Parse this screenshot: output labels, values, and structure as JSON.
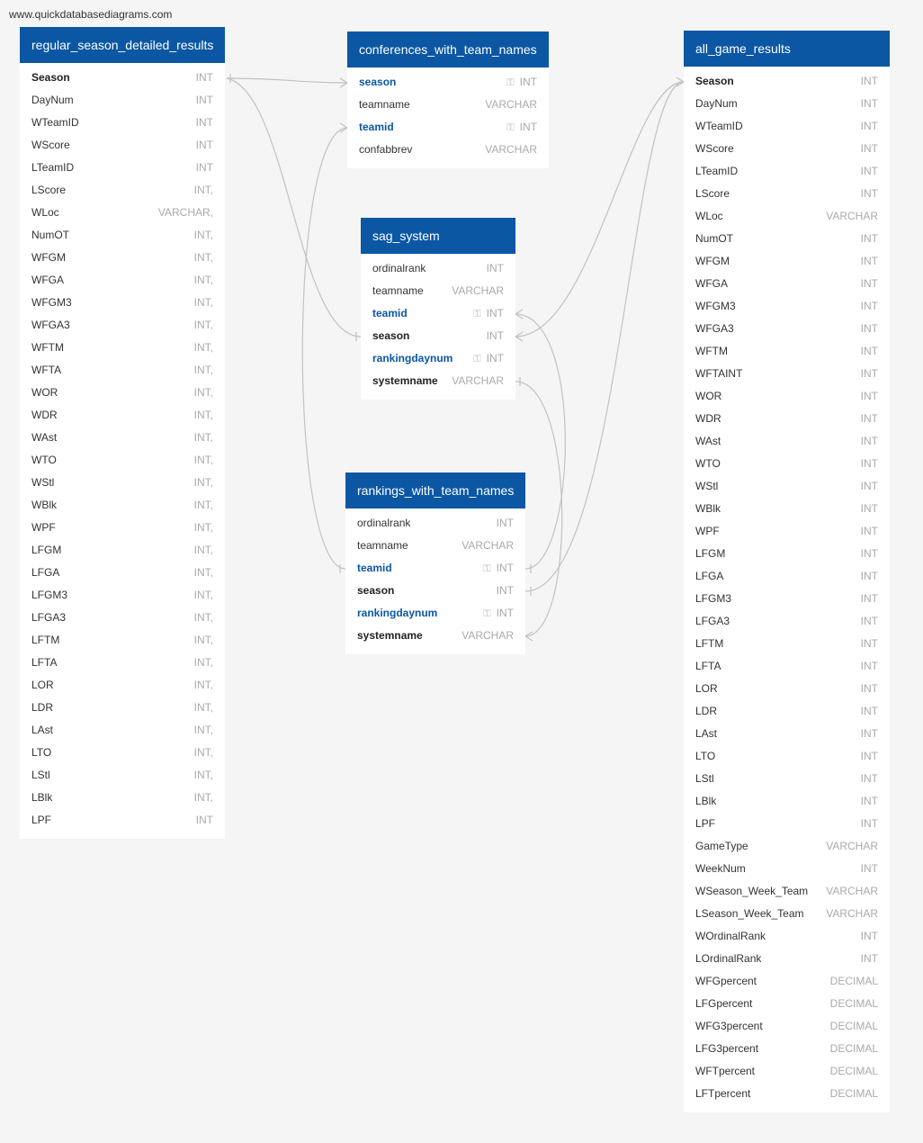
{
  "site": {
    "url": "www.quickdatabasediagrams.com"
  },
  "tables": {
    "regular_season_detailed_results": {
      "title": "regular_season_detailed_results",
      "fields": [
        {
          "name": "Season",
          "type": "INT",
          "style": "bold"
        },
        {
          "name": "DayNum",
          "type": "INT"
        },
        {
          "name": "WTeamID",
          "type": "INT"
        },
        {
          "name": "WScore",
          "type": "INT"
        },
        {
          "name": "LTeamID",
          "type": "INT"
        },
        {
          "name": "LScore",
          "type": "INT,"
        },
        {
          "name": "WLoc",
          "type": "VARCHAR,"
        },
        {
          "name": "NumOT",
          "type": "INT,"
        },
        {
          "name": "WFGM",
          "type": "INT,"
        },
        {
          "name": "WFGA",
          "type": "INT,"
        },
        {
          "name": "WFGM3",
          "type": "INT,"
        },
        {
          "name": "WFGA3",
          "type": "INT,"
        },
        {
          "name": "WFTM",
          "type": "INT,"
        },
        {
          "name": "WFTA",
          "type": "INT,"
        },
        {
          "name": "WOR",
          "type": "INT,"
        },
        {
          "name": "WDR",
          "type": "INT,"
        },
        {
          "name": "WAst",
          "type": "INT,"
        },
        {
          "name": "WTO",
          "type": "INT,"
        },
        {
          "name": "WStl",
          "type": "INT,"
        },
        {
          "name": "WBlk",
          "type": "INT,"
        },
        {
          "name": "WPF",
          "type": "INT,"
        },
        {
          "name": "LFGM",
          "type": "INT,"
        },
        {
          "name": "LFGA",
          "type": "INT,"
        },
        {
          "name": "LFGM3",
          "type": "INT,"
        },
        {
          "name": "LFGA3",
          "type": "INT,"
        },
        {
          "name": "LFTM",
          "type": "INT,"
        },
        {
          "name": "LFTA",
          "type": "INT,"
        },
        {
          "name": "LOR",
          "type": "INT,"
        },
        {
          "name": "LDR",
          "type": "INT,"
        },
        {
          "name": "LAst",
          "type": "INT,"
        },
        {
          "name": "LTO",
          "type": "INT,"
        },
        {
          "name": "LStl",
          "type": "INT,"
        },
        {
          "name": "LBlk",
          "type": "INT,"
        },
        {
          "name": "LPF",
          "type": "INT"
        }
      ]
    },
    "conferences_with_team_names": {
      "title": "conferences_with_team_names",
      "fields": [
        {
          "name": "season",
          "type": "INT",
          "style": "key"
        },
        {
          "name": "teamname",
          "type": "VARCHAR"
        },
        {
          "name": "teamid",
          "type": "INT",
          "style": "key"
        },
        {
          "name": "confabbrev",
          "type": "VARCHAR"
        }
      ]
    },
    "sag_system": {
      "title": "sag_system",
      "fields": [
        {
          "name": "ordinalrank",
          "type": "INT"
        },
        {
          "name": "teamname",
          "type": "VARCHAR"
        },
        {
          "name": "teamid",
          "type": "INT",
          "style": "key"
        },
        {
          "name": "season",
          "type": "INT",
          "style": "bold"
        },
        {
          "name": "rankingdaynum",
          "type": "INT",
          "style": "key"
        },
        {
          "name": "systemname",
          "type": "VARCHAR",
          "style": "bold"
        }
      ]
    },
    "rankings_with_team_names": {
      "title": "rankings_with_team_names",
      "fields": [
        {
          "name": "ordinalrank",
          "type": "INT"
        },
        {
          "name": "teamname",
          "type": "VARCHAR"
        },
        {
          "name": "teamid",
          "type": "INT",
          "style": "key"
        },
        {
          "name": "season",
          "type": "INT",
          "style": "bold"
        },
        {
          "name": "rankingdaynum",
          "type": "INT",
          "style": "key"
        },
        {
          "name": "systemname",
          "type": "VARCHAR",
          "style": "bold"
        }
      ]
    },
    "all_game_results": {
      "title": "all_game_results",
      "fields": [
        {
          "name": "Season",
          "type": "INT",
          "style": "bold"
        },
        {
          "name": "DayNum",
          "type": "INT"
        },
        {
          "name": "WTeamID",
          "type": "INT"
        },
        {
          "name": "WScore",
          "type": "INT"
        },
        {
          "name": "LTeamID",
          "type": "INT"
        },
        {
          "name": "LScore",
          "type": "INT"
        },
        {
          "name": "WLoc",
          "type": "VARCHAR"
        },
        {
          "name": "NumOT",
          "type": "INT"
        },
        {
          "name": "WFGM",
          "type": "INT"
        },
        {
          "name": "WFGA",
          "type": "INT"
        },
        {
          "name": "WFGM3",
          "type": "INT"
        },
        {
          "name": "WFGA3",
          "type": "INT"
        },
        {
          "name": "WFTM",
          "type": "INT"
        },
        {
          "name": "WFTAINT",
          "type": "INT"
        },
        {
          "name": "WOR",
          "type": "INT"
        },
        {
          "name": "WDR",
          "type": "INT"
        },
        {
          "name": "WAst",
          "type": "INT"
        },
        {
          "name": "WTO",
          "type": "INT"
        },
        {
          "name": "WStl",
          "type": "INT"
        },
        {
          "name": "WBlk",
          "type": "INT"
        },
        {
          "name": "WPF",
          "type": "INT"
        },
        {
          "name": "LFGM",
          "type": "INT"
        },
        {
          "name": "LFGA",
          "type": "INT"
        },
        {
          "name": "LFGM3",
          "type": "INT"
        },
        {
          "name": "LFGA3",
          "type": "INT"
        },
        {
          "name": "LFTM",
          "type": "INT"
        },
        {
          "name": "LFTA",
          "type": "INT"
        },
        {
          "name": "LOR",
          "type": "INT"
        },
        {
          "name": "LDR",
          "type": "INT"
        },
        {
          "name": "LAst",
          "type": "INT"
        },
        {
          "name": "LTO",
          "type": "INT"
        },
        {
          "name": "LStl",
          "type": "INT"
        },
        {
          "name": "LBlk",
          "type": "INT"
        },
        {
          "name": "LPF",
          "type": "INT"
        },
        {
          "name": "GameType",
          "type": "VARCHAR"
        },
        {
          "name": "WeekNum",
          "type": "INT"
        },
        {
          "name": "WSeason_Week_Team",
          "type": "VARCHAR"
        },
        {
          "name": "LSeason_Week_Team",
          "type": "VARCHAR"
        },
        {
          "name": "WOrdinalRank",
          "type": "INT"
        },
        {
          "name": "LOrdinalRank",
          "type": "INT"
        },
        {
          "name": "WFGpercent",
          "type": "DECIMAL"
        },
        {
          "name": "LFGpercent",
          "type": "DECIMAL"
        },
        {
          "name": "WFG3percent",
          "type": "DECIMAL"
        },
        {
          "name": "LFG3percent",
          "type": "DECIMAL"
        },
        {
          "name": "WFTpercent",
          "type": "DECIMAL"
        },
        {
          "name": "LFTpercent",
          "type": "DECIMAL"
        }
      ]
    }
  },
  "colors": {
    "header": "#0b57a4",
    "key_field": "#0b57a4",
    "connector": "#c2c2c2",
    "background": "#f4f5f4"
  }
}
